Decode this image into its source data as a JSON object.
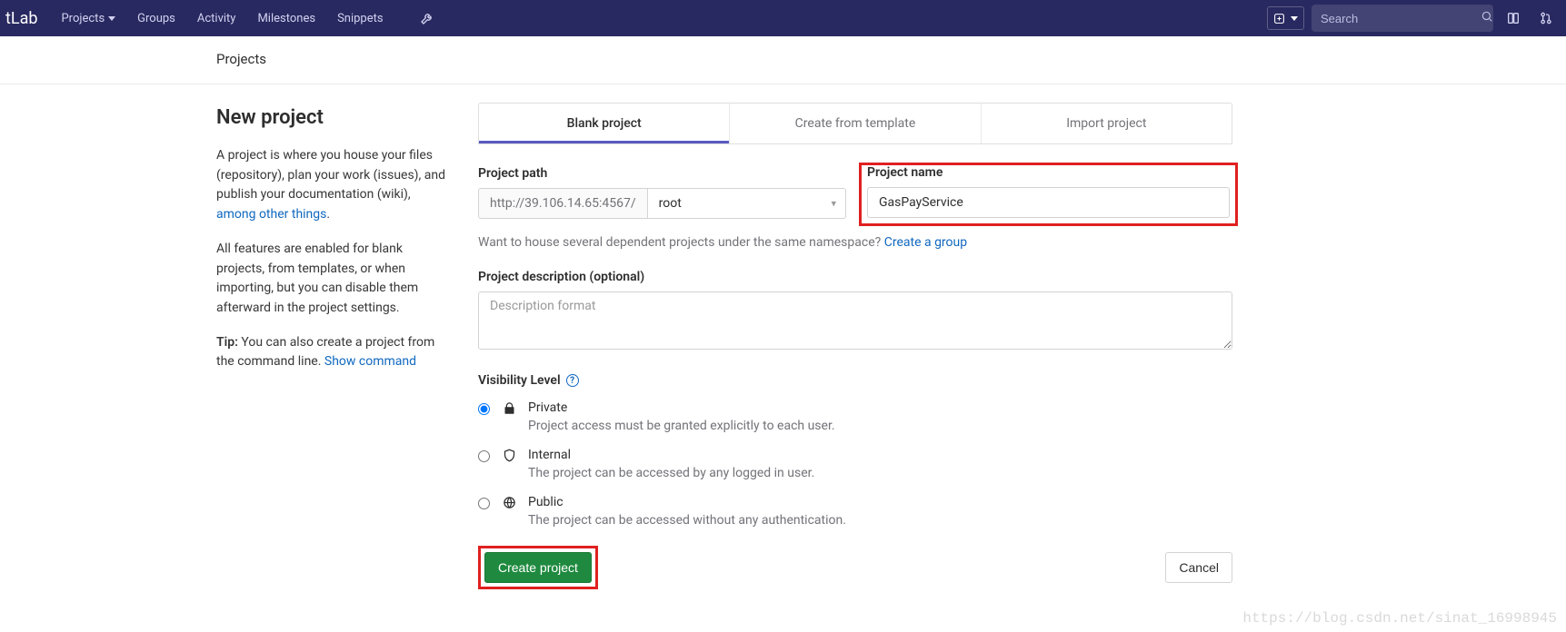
{
  "navbar": {
    "brand": "tLab",
    "links": {
      "projects": "Projects",
      "groups": "Groups",
      "activity": "Activity",
      "milestones": "Milestones",
      "snippets": "Snippets"
    },
    "search_placeholder": "Search"
  },
  "breadcrumb": {
    "projects": "Projects"
  },
  "sidebar": {
    "title": "New project",
    "p1_a": "A project is where you house your files (repository), plan your work (issues), and publish your documentation (wiki), ",
    "p1_link": "among other things",
    "p1_b": ".",
    "p2": "All features are enabled for blank projects, from templates, or when importing, but you can disable them afterward in the project settings.",
    "tip_label": "Tip:",
    "tip_text": " You can also create a project from the command line. ",
    "tip_link": "Show command"
  },
  "tabs": {
    "blank": "Blank project",
    "template": "Create from template",
    "import": "Import project"
  },
  "form": {
    "path_label": "Project path",
    "path_prefix": "http://39.106.14.65:4567/",
    "namespace_value": "root",
    "name_label": "Project name",
    "name_value": "GasPayService",
    "namespace_hint_a": "Want to house several dependent projects under the same namespace? ",
    "namespace_hint_link": "Create a group",
    "desc_label": "Project description (optional)",
    "desc_placeholder": "Description format",
    "vis_label": "Visibility Level",
    "vis": {
      "private_name": "Private",
      "private_desc": "Project access must be granted explicitly to each user.",
      "internal_name": "Internal",
      "internal_desc": "The project can be accessed by any logged in user.",
      "public_name": "Public",
      "public_desc": "The project can be accessed without any authentication."
    },
    "create_btn": "Create project",
    "cancel_btn": "Cancel"
  },
  "watermark": "https://blog.csdn.net/sinat_16998945"
}
